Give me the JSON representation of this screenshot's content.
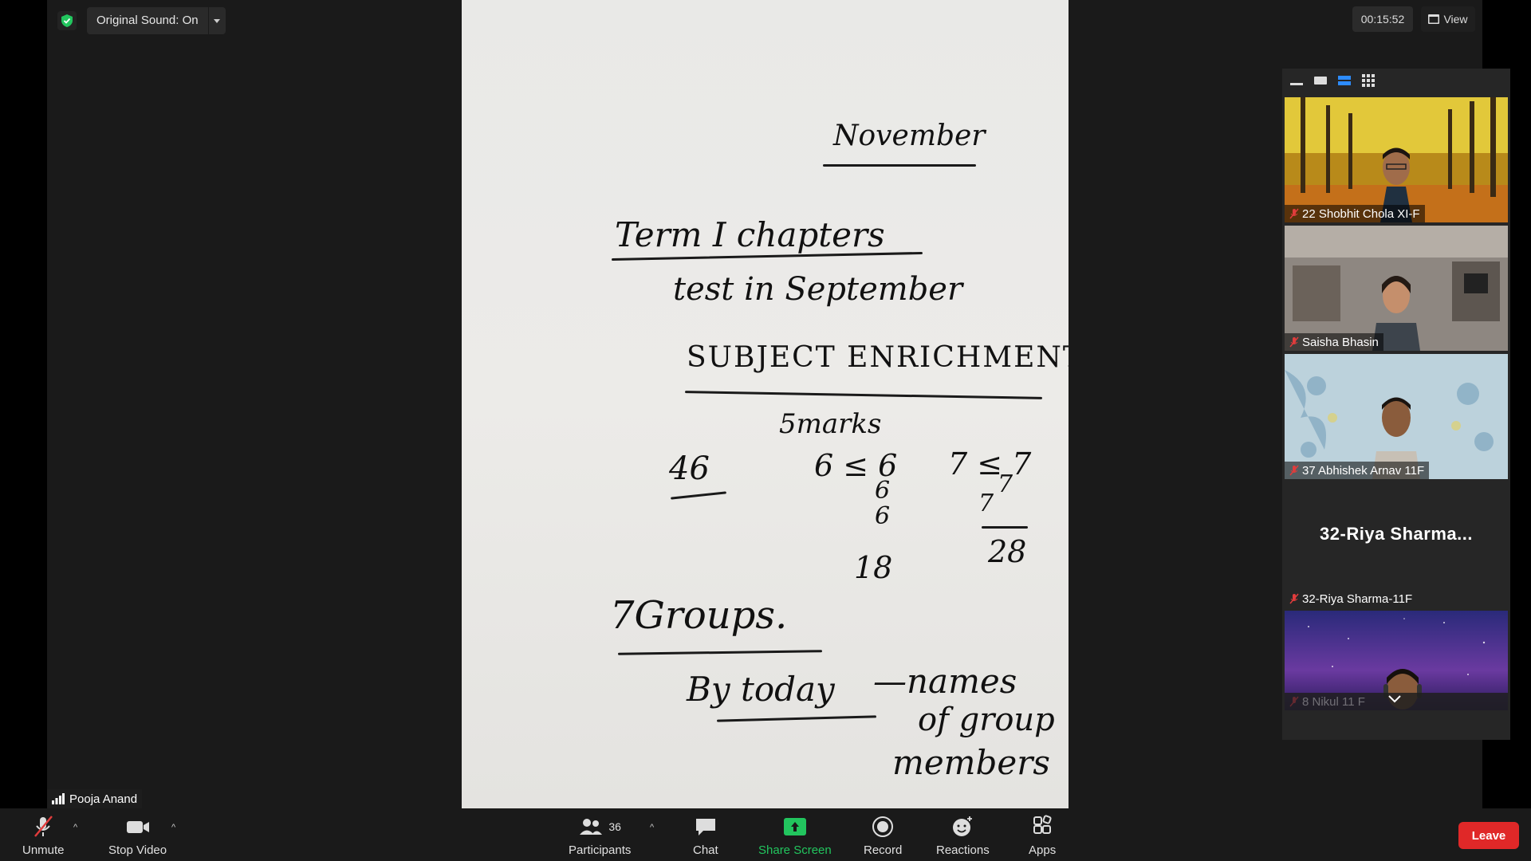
{
  "top_bar": {
    "encryption_icon": "shield-check-icon",
    "original_sound_label": "Original Sound: On",
    "timer": "00:15:52",
    "view_label": "View"
  },
  "whiteboard": {
    "lines": {
      "month": "November",
      "term": "Term I chapters",
      "test": "test in September",
      "subject": "SUBJECT ENRICHMENT",
      "marks": "5marks",
      "n46": "46",
      "sum6a": "6 ≤ 6",
      "sum6b": "6",
      "sum6c": "6",
      "sum7a": "7 ≤ 7",
      "sum7b": "7",
      "sum7c": "7",
      "n28": "28",
      "n18": "18",
      "groups": "7Groups.",
      "today": "By today",
      "names": "—names",
      "of_group": "of group",
      "members": "members"
    }
  },
  "speaker": {
    "name": "Pooja Anand",
    "signal_icon": "signal-bars-icon"
  },
  "gallery": {
    "view_icons": [
      "minimize-icon",
      "speaker-view-icon",
      "strip-view-icon",
      "grid-view-icon"
    ],
    "participants": [
      {
        "name": "22 Shobhit Chola XI-F",
        "muted": true
      },
      {
        "name": "Saisha Bhasin",
        "muted": true
      },
      {
        "name": "37 Abhishek Arnav 11F",
        "muted": true
      },
      {
        "name": "32-Riya Sharma-11F",
        "big_name": "32-Riya  Sharma...",
        "muted": true
      },
      {
        "name": "8 Nikul 11 F",
        "muted": true
      }
    ],
    "scroll_down_icon": "chevron-down-icon"
  },
  "toolbar": {
    "unmute": "Unmute",
    "stop_video": "Stop Video",
    "participants": "Participants",
    "participants_count": "36",
    "chat": "Chat",
    "share_screen": "Share Screen",
    "record": "Record",
    "reactions": "Reactions",
    "apps": "Apps",
    "leave": "Leave"
  },
  "colors": {
    "accent_green": "#22c55e",
    "accent_blue": "#2d8cff",
    "leave_red": "#e02828",
    "mute_red": "#e03c3c"
  }
}
